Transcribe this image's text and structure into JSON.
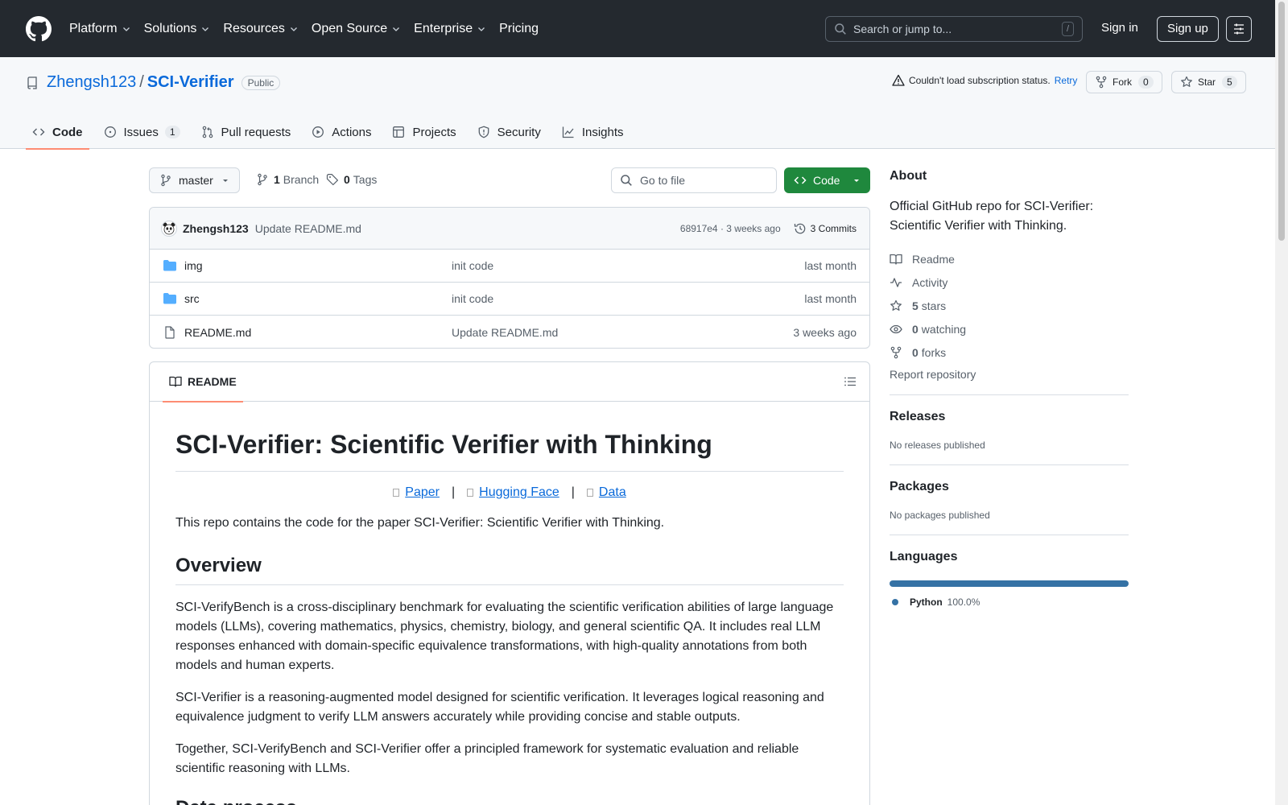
{
  "header": {
    "nav": [
      "Platform",
      "Solutions",
      "Resources",
      "Open Source",
      "Enterprise",
      "Pricing"
    ],
    "search_placeholder": "Search or jump to...",
    "search_shortcut": "/",
    "sign_in": "Sign in",
    "sign_up": "Sign up"
  },
  "repo": {
    "owner": "Zhengsh123",
    "separator": "/",
    "name": "SCI-Verifier",
    "visibility": "Public",
    "subscription_status": "Couldn't load subscription status.",
    "retry": "Retry",
    "fork_label": "Fork",
    "fork_count": "0",
    "star_label": "Star",
    "star_count": "5"
  },
  "tabs": [
    {
      "label": "Code",
      "icon": "code-icon"
    },
    {
      "label": "Issues",
      "icon": "issue-icon",
      "count": "1"
    },
    {
      "label": "Pull requests",
      "icon": "pull-request-icon"
    },
    {
      "label": "Actions",
      "icon": "play-icon"
    },
    {
      "label": "Projects",
      "icon": "table-icon"
    },
    {
      "label": "Security",
      "icon": "shield-icon"
    },
    {
      "label": "Insights",
      "icon": "graph-icon"
    }
  ],
  "toolbar": {
    "branch": "master",
    "branch_count": "1",
    "branch_label": "Branch",
    "tag_count": "0",
    "tag_label": "Tags",
    "goto_placeholder": "Go to file",
    "code_button": "Code"
  },
  "latest_commit": {
    "author": "Zhengsh123",
    "message": "Update README.md",
    "hash_time": "68917e4 · 3 weeks ago",
    "commits_label": "3 Commits"
  },
  "files": [
    {
      "name": "img",
      "type": "folder",
      "message": "init code",
      "time": "last month"
    },
    {
      "name": "src",
      "type": "folder",
      "message": "init code",
      "time": "last month"
    },
    {
      "name": "README.md",
      "type": "file",
      "message": "Update README.md",
      "time": "3 weeks ago"
    }
  ],
  "readme": {
    "tab_label": "README",
    "title": "SCI-Verifier: Scientific Verifier with Thinking",
    "links": [
      "Paper",
      "Hugging Face",
      "Data"
    ],
    "link_separator": "|",
    "intro": "This repo contains the code for the paper SCI-Verifier: Scientific Verifier with Thinking.",
    "overview_heading": "Overview",
    "overview_p1": "SCI-VerifyBench is a cross-disciplinary benchmark for evaluating the scientific verification abilities of large language models (LLMs), covering mathematics, physics, chemistry, biology, and general scientific QA. It includes real LLM responses enhanced with domain-specific equivalence transformations, with high-quality annotations from both models and human experts.",
    "overview_p2": "SCI-Verifier is a reasoning-augmented model designed for scientific verification. It leverages logical reasoning and equivalence judgment to verify LLM answers accurately while providing concise and stable outputs.",
    "overview_p3": "Together, SCI-VerifyBench and SCI-Verifier offer a principled framework for systematic evaluation and reliable scientific reasoning with LLMs.",
    "next_heading": "Data process"
  },
  "sidebar": {
    "about_heading": "About",
    "about_desc": "Official GitHub repo for SCI-Verifier: Scientific Verifier with Thinking.",
    "readme": "Readme",
    "activity": "Activity",
    "stars_count": "5",
    "stars_label": "stars",
    "watching_count": "0",
    "watching_label": "watching",
    "forks_count": "0",
    "forks_label": "forks",
    "report": "Report repository",
    "releases_heading": "Releases",
    "releases_text": "No releases published",
    "packages_heading": "Packages",
    "packages_text": "No packages published",
    "languages_heading": "Languages",
    "language_name": "Python",
    "language_pct": "100.0%",
    "language_fraction": 1.0,
    "language_color": "#3572a5"
  },
  "colors": {
    "header_bg": "#24292f",
    "link": "#0969da",
    "primary_button": "#1f883d",
    "active_tab_underline": "#fd8c73"
  }
}
